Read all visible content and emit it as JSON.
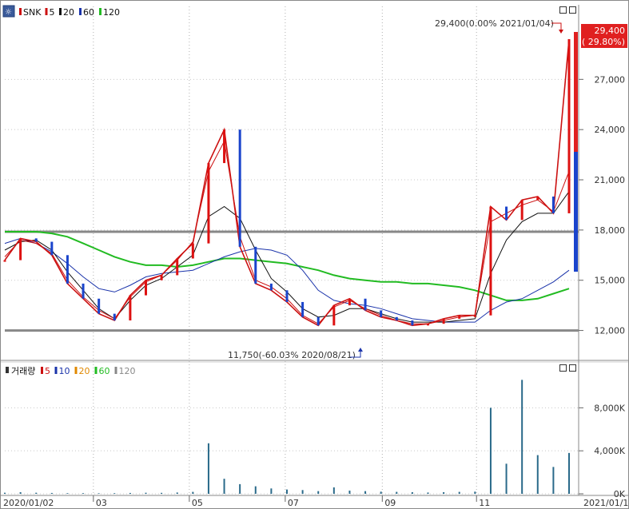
{
  "chart_data": [
    {
      "type": "candlestick",
      "legend": [
        {
          "label": "SNK",
          "color": "#cc1111"
        },
        {
          "label": "5",
          "color": "#cc1111"
        },
        {
          "label": "20",
          "color": "#111111"
        },
        {
          "label": "60",
          "color": "#1a33aa"
        },
        {
          "label": "120",
          "color": "#22bb22"
        }
      ],
      "y_ticks": [
        "27,000",
        "24,000",
        "21,000",
        "18,000",
        "15,000",
        "12,000"
      ],
      "y_tick_values": [
        27000,
        24000,
        21000,
        18000,
        15000,
        12000
      ],
      "ylim": [
        10500,
        30500
      ],
      "x_ticks": [
        "2020/01/02",
        "03",
        "05",
        "07",
        "09",
        "11",
        "2021/01/11"
      ],
      "annotations": {
        "high": "29,400(0.00% 2021/01/04)",
        "low": "11,750(-60.03% 2020/08/21)",
        "current_price": "29,400",
        "current_change": "( 29.80%)"
      },
      "horizontal_lines": [
        17900,
        12000
      ],
      "series": [
        {
          "name": "SNK",
          "values": [
            16200,
            17500,
            17300,
            16500,
            14800,
            13900,
            13000,
            12600,
            14100,
            15000,
            15300,
            16300,
            17200,
            22000,
            24000,
            17000,
            14800,
            14400,
            13700,
            12800,
            12300,
            13500,
            13900,
            13200,
            12800,
            12600,
            12300,
            12400,
            12700,
            12900,
            12900,
            19400,
            18600,
            19800,
            20000,
            19000,
            29400
          ]
        },
        {
          "name": "5",
          "values": [
            16400,
            17400,
            17200,
            16600,
            15000,
            14000,
            13200,
            12700,
            14000,
            14900,
            15300,
            16200,
            17300,
            21500,
            23300,
            17600,
            15000,
            14600,
            13900,
            12900,
            12400,
            13400,
            13800,
            13300,
            12900,
            12600,
            12400,
            12400,
            12600,
            12800,
            12900,
            18500,
            19000,
            19500,
            19800,
            19100,
            21500
          ]
        },
        {
          "name": "20",
          "values": [
            16800,
            17300,
            17400,
            16800,
            15500,
            14400,
            13300,
            12700,
            13800,
            14700,
            15100,
            15800,
            16500,
            18800,
            19400,
            18700,
            16800,
            15100,
            14300,
            13300,
            12800,
            12900,
            13300,
            13300,
            13000,
            12700,
            12500,
            12500,
            12500,
            12600,
            12700,
            15400,
            17400,
            18500,
            19000,
            19000,
            20300
          ]
        },
        {
          "name": "60",
          "values": [
            17200,
            17500,
            17200,
            16700,
            16000,
            15200,
            14500,
            14300,
            14700,
            15200,
            15400,
            15500,
            15600,
            16000,
            16400,
            16700,
            16900,
            16800,
            16500,
            15600,
            14400,
            13800,
            13600,
            13500,
            13300,
            13000,
            12700,
            12600,
            12500,
            12500,
            12500,
            13200,
            13700,
            13900,
            14400,
            14900,
            15600
          ]
        },
        {
          "name": "120",
          "values": [
            17900,
            17900,
            17900,
            17800,
            17600,
            17200,
            16800,
            16400,
            16100,
            15900,
            15900,
            15800,
            15900,
            16100,
            16300,
            16300,
            16200,
            16100,
            16000,
            15800,
            15600,
            15300,
            15100,
            15000,
            14900,
            14900,
            14800,
            14800,
            14700,
            14600,
            14400,
            14100,
            13800,
            13800,
            13900,
            14200,
            14500
          ]
        }
      ]
    },
    {
      "type": "bar",
      "legend": [
        {
          "label": "거래량",
          "color": "#111111"
        },
        {
          "label": "5",
          "color": "#cc1111"
        },
        {
          "label": "10",
          "color": "#1a33aa"
        },
        {
          "label": "20",
          "color": "#e08800"
        },
        {
          "label": "60",
          "color": "#22bb22"
        },
        {
          "label": "120",
          "color": "#888888"
        }
      ],
      "y_ticks": [
        "8,000K",
        "4,000K",
        "0K"
      ],
      "y_tick_values": [
        8000,
        4000,
        0
      ],
      "ylim": [
        0,
        11000
      ],
      "series": [
        {
          "name": "거래량",
          "values": [
            100,
            150,
            100,
            80,
            60,
            60,
            50,
            60,
            80,
            100,
            90,
            120,
            180,
            4700,
            1400,
            900,
            700,
            500,
            400,
            350,
            250,
            600,
            300,
            250,
            200,
            180,
            150,
            120,
            150,
            180,
            200,
            8000,
            2800,
            10600,
            3600,
            2500,
            3800
          ]
        }
      ]
    }
  ]
}
